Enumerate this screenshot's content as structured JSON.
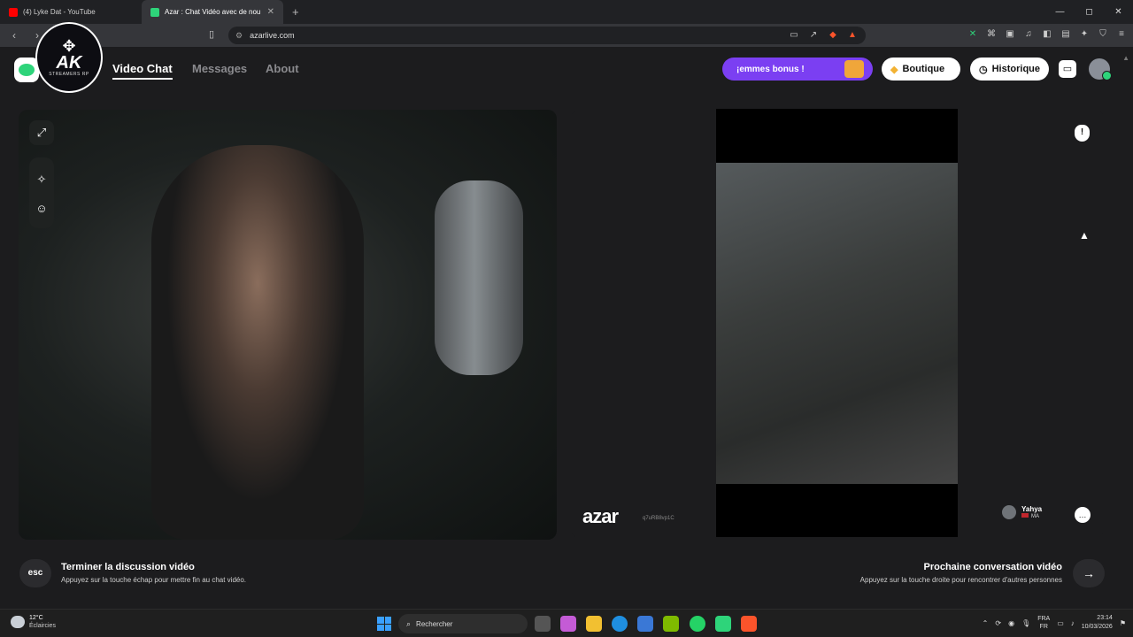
{
  "browser": {
    "tabs": [
      {
        "title": "(4) Lyke Dat - YouTube",
        "active": false,
        "favicon_color": "#ff0000"
      },
      {
        "title": "Azar : Chat Vidéo avec de nou",
        "active": true,
        "favicon_color": "#2ed47a"
      }
    ],
    "new_tab": "+",
    "window_controls": {
      "minimize": "—",
      "maximize": "◻",
      "close": "✕"
    },
    "url": "azarlive.com"
  },
  "site": {
    "badge": {
      "logo": "AK",
      "subtitle": "STREAMERS RP"
    },
    "nav": [
      {
        "label": "Video Chat",
        "active": true
      },
      {
        "label": "Messages",
        "active": false
      },
      {
        "label": "About",
        "active": false
      }
    ],
    "bonus_label": "¡emmes bonus !",
    "shop_label": "Boutique",
    "history_label": "Historique"
  },
  "video": {
    "watermark": "azar",
    "watermark_id": "q7uRB8vp1C",
    "peer": {
      "name": "Yahya",
      "country": "MA"
    }
  },
  "controls": {
    "esc_key": "esc",
    "end_title": "Terminer la discussion vidéo",
    "end_subtitle": "Appuyez sur la touche échap pour mettre fin au chat vidéo.",
    "next_title": "Prochaine conversation vidéo",
    "next_subtitle": "Appuyez sur la touche droite pour rencontrer d'autres personnes",
    "next_arrow": "→"
  },
  "taskbar": {
    "weather_temp": "12°C",
    "weather_desc": "Éclaircies",
    "search_placeholder": "Rechercher",
    "lang_top": "FRA",
    "lang_bottom": "FR",
    "time": "23:14",
    "date": "10/03/2026"
  },
  "colors": {
    "accent_green": "#2ed47a",
    "bonus_purple": "#7b3ff2",
    "page_bg": "#1c1c1e"
  }
}
